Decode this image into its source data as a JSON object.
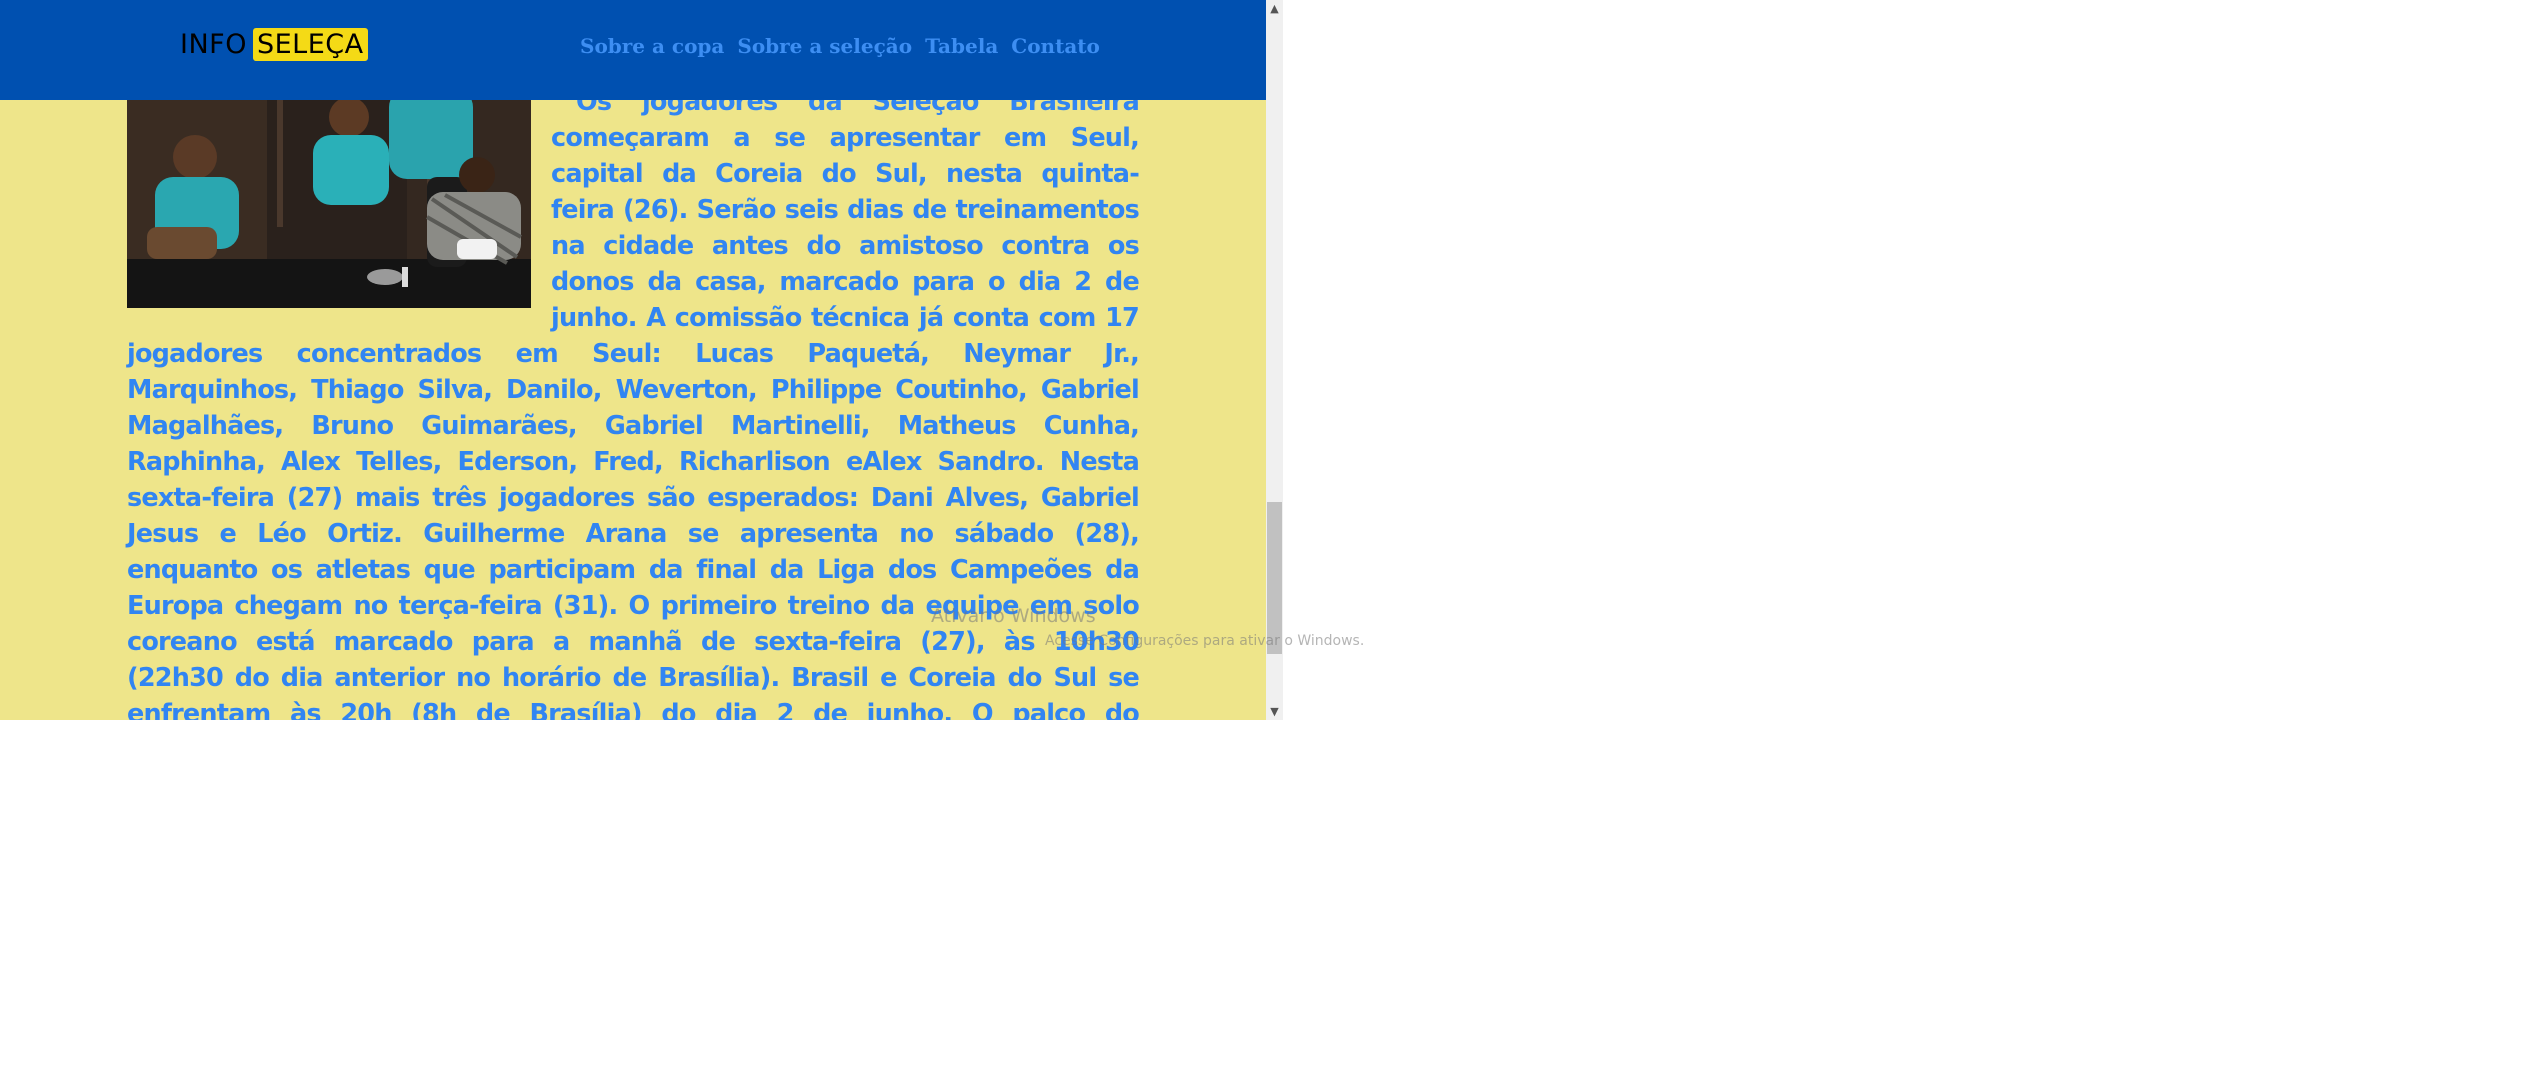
{
  "header": {
    "logo_plain": "INFO",
    "logo_highlight": "SELEÇA",
    "nav": [
      {
        "label": "Sobre a copa"
      },
      {
        "label": "Sobre a seleção"
      },
      {
        "label": "Tabela"
      },
      {
        "label": "Contato"
      }
    ]
  },
  "article": {
    "text": "Os jogadores da Seleção Brasileira começaram a se apresentar em Seul, capital da Coreia do Sul, nesta quinta-feira (26). Serão seis dias de treinamentos na cidade antes do amistoso contra os donos da casa, marcado para o dia 2 de junho. A comissão técnica já conta com 17 jogadores concentrados em Seul: Lucas Paquetá, Neymar Jr., Marquinhos, Thiago Silva, Danilo, Weverton, Philippe Coutinho, Gabriel Magalhães, Bruno Guimarães, Gabriel Martinelli, Matheus Cunha, Raphinha, Alex Telles, Ederson, Fred, Richarlison eAlex Sandro. Nesta sexta-feira (27) mais três jogadores são esperados: Dani Alves, Gabriel Jesus e Léo Ortiz. Guilherme Arana se apresenta no sábado (28), enquanto os atletas que participam da final da Liga dos Campeões da Europa chegam no terça-feira (31). O primeiro treino da equipe em solo coreano está marcado para a manhã de sexta-feira (27), às 10h30 (22h30 do dia anterior no horário de Brasília). Brasil e Coreia do Sul se enfrentam às 20h (8h de Brasília) do dia 2 de junho. O palco do confronto será o Seoul World Cup Stadium."
  },
  "scrollbar": {
    "up_icon": "▲",
    "down_icon": "▼"
  },
  "watermark": {
    "title": "Ativar o Windows",
    "subtitle": "Acesse Configurações para ativar o Windows."
  },
  "colors": {
    "header_bg": "#0050b0",
    "page_bg": "#eee58a",
    "link_text": "#3d8ef2",
    "article_text": "#3185f2",
    "logo_highlight": "#f4da16"
  }
}
